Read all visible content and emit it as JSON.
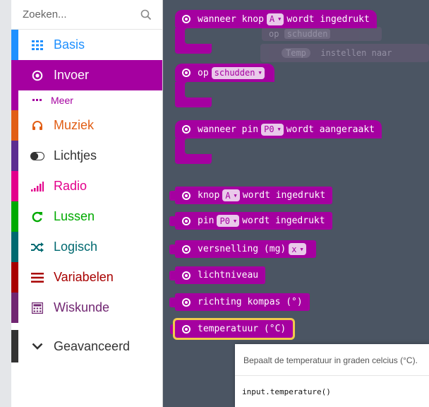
{
  "search": {
    "placeholder": "Zoeken..."
  },
  "categories": [
    {
      "label": "Basis",
      "color": "#1e90ff"
    },
    {
      "label": "Invoer",
      "color": "#a500a0"
    },
    {
      "label": "Meer",
      "color": "#a500a0"
    },
    {
      "label": "Muziek",
      "color": "#e15e15"
    },
    {
      "label": "Lichtjes",
      "color": "#5c2d91"
    },
    {
      "label": "Radio",
      "color": "#e3008c"
    },
    {
      "label": "Lussen",
      "color": "#00aa00"
    },
    {
      "label": "Logisch",
      "color": "#006970"
    },
    {
      "label": "Variabelen",
      "color": "#a80000"
    },
    {
      "label": "Wiskunde",
      "color": "#712672"
    },
    {
      "label": "Geavanceerd",
      "color": "#333333"
    }
  ],
  "workspace": {
    "ghost": {
      "op": "op",
      "schudden": "schudden",
      "temp": "Temp",
      "instellen": "instellen naar"
    },
    "blocks": {
      "knop_hat": {
        "pre": "wanneer knop",
        "dd": "A",
        "post": "wordt ingedrukt"
      },
      "op_hat": {
        "pre": "op",
        "dd": "schudden"
      },
      "pin_hat": {
        "pre": "wanneer pin",
        "dd": "P0",
        "post": "wordt aangeraakt"
      },
      "knop_rep": {
        "pre": "knop",
        "dd": "A",
        "post": "wordt ingedrukt"
      },
      "pin_rep": {
        "pre": "pin",
        "dd": "P0",
        "post": "wordt ingedrukt"
      },
      "versnelling": {
        "pre": "versnelling (mg)",
        "dd": "x"
      },
      "lichtniveau": {
        "pre": "lichtniveau"
      },
      "kompas": {
        "pre": "richting kompas (°)"
      },
      "temperatuur": {
        "pre": "temperatuur (°C)"
      }
    }
  },
  "tooltip": {
    "description": "Bepaalt de temperatuur in graden celcius (°C).",
    "code": "input.temperature()"
  },
  "colors": {
    "input": "#a500a0",
    "workspace": "#4b5563",
    "selected_outline": "#f2c94c"
  }
}
